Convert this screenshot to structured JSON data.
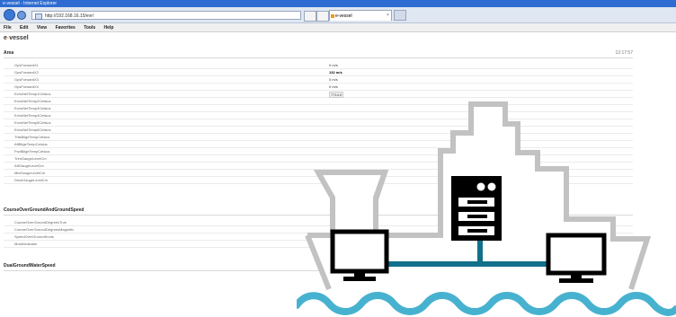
{
  "browser": {
    "title": "e-vessel - Internet Explorer",
    "url": "http://192.168.16.15/evr/",
    "tab_label": "e-vessel",
    "tab_close": "×",
    "menu": [
      "File",
      "Edit",
      "View",
      "Favorites",
      "Tools",
      "Help"
    ]
  },
  "page": {
    "brand_prefix": "e",
    "brand_dash": "-",
    "brand_suffix": "vessel"
  },
  "sections": {
    "area": {
      "title": "Area",
      "right_text": "12:17:57"
    },
    "course": {
      "title": "CourseOverGroundAndGroundSpeed"
    },
    "dual": {
      "title": "DualGroundWaterSpeed"
    }
  },
  "area_rows": [
    {
      "label": "GpsForwardX1",
      "value": "0 m/s"
    },
    {
      "label": "GpsForwardX2",
      "value": "132 m/s"
    },
    {
      "label": "GpsForwardX3",
      "value": "0 m/s"
    },
    {
      "label": "GpsForwardX4",
      "value": "0 m/s"
    },
    {
      "label": "EchoNetTemp1Celsius",
      "value": "7714.0"
    },
    {
      "label": "EchoNetTemp2Celsius",
      "value": ""
    },
    {
      "label": "EchoNetTemp3Celsius",
      "value": ""
    },
    {
      "label": "EchoNetTemp4Celsius",
      "value": ""
    },
    {
      "label": "EchoNetTemp5Celsius",
      "value": ""
    },
    {
      "label": "EchoNetTemp6Celsius",
      "value": ""
    },
    {
      "label": "ThisBilgeTempCelsius",
      "value": ""
    },
    {
      "label": "AftBilgeTempCelsius",
      "value": ""
    },
    {
      "label": "FwdBilgeTempCelsius",
      "value": ""
    },
    {
      "label": "TrimGaugeLevelCm",
      "value": ""
    },
    {
      "label": "AftGaugeLevelCm",
      "value": ""
    },
    {
      "label": "MidGaugeLevelCm",
      "value": ""
    },
    {
      "label": "DeckGaugeLevelCm",
      "value": ""
    }
  ],
  "course_rows": [
    {
      "label": "CourseOverGroundDegreesTrue",
      "value": ""
    },
    {
      "label": "CourseOverGroundDegreesMagnetic",
      "value": ""
    },
    {
      "label": "SpeedOverGroundKnots",
      "value": ""
    },
    {
      "label": "ModeIndicator",
      "value": ""
    }
  ],
  "icons": {
    "ship": "ship-illustration",
    "server": "server-icon",
    "monitor": "monitor-icon",
    "waves": "waves"
  },
  "colors": {
    "ship_outline": "#c2c2c2",
    "network": "#13708a",
    "waves": "#47b2cf",
    "brand_accent": "#f39a1e"
  }
}
